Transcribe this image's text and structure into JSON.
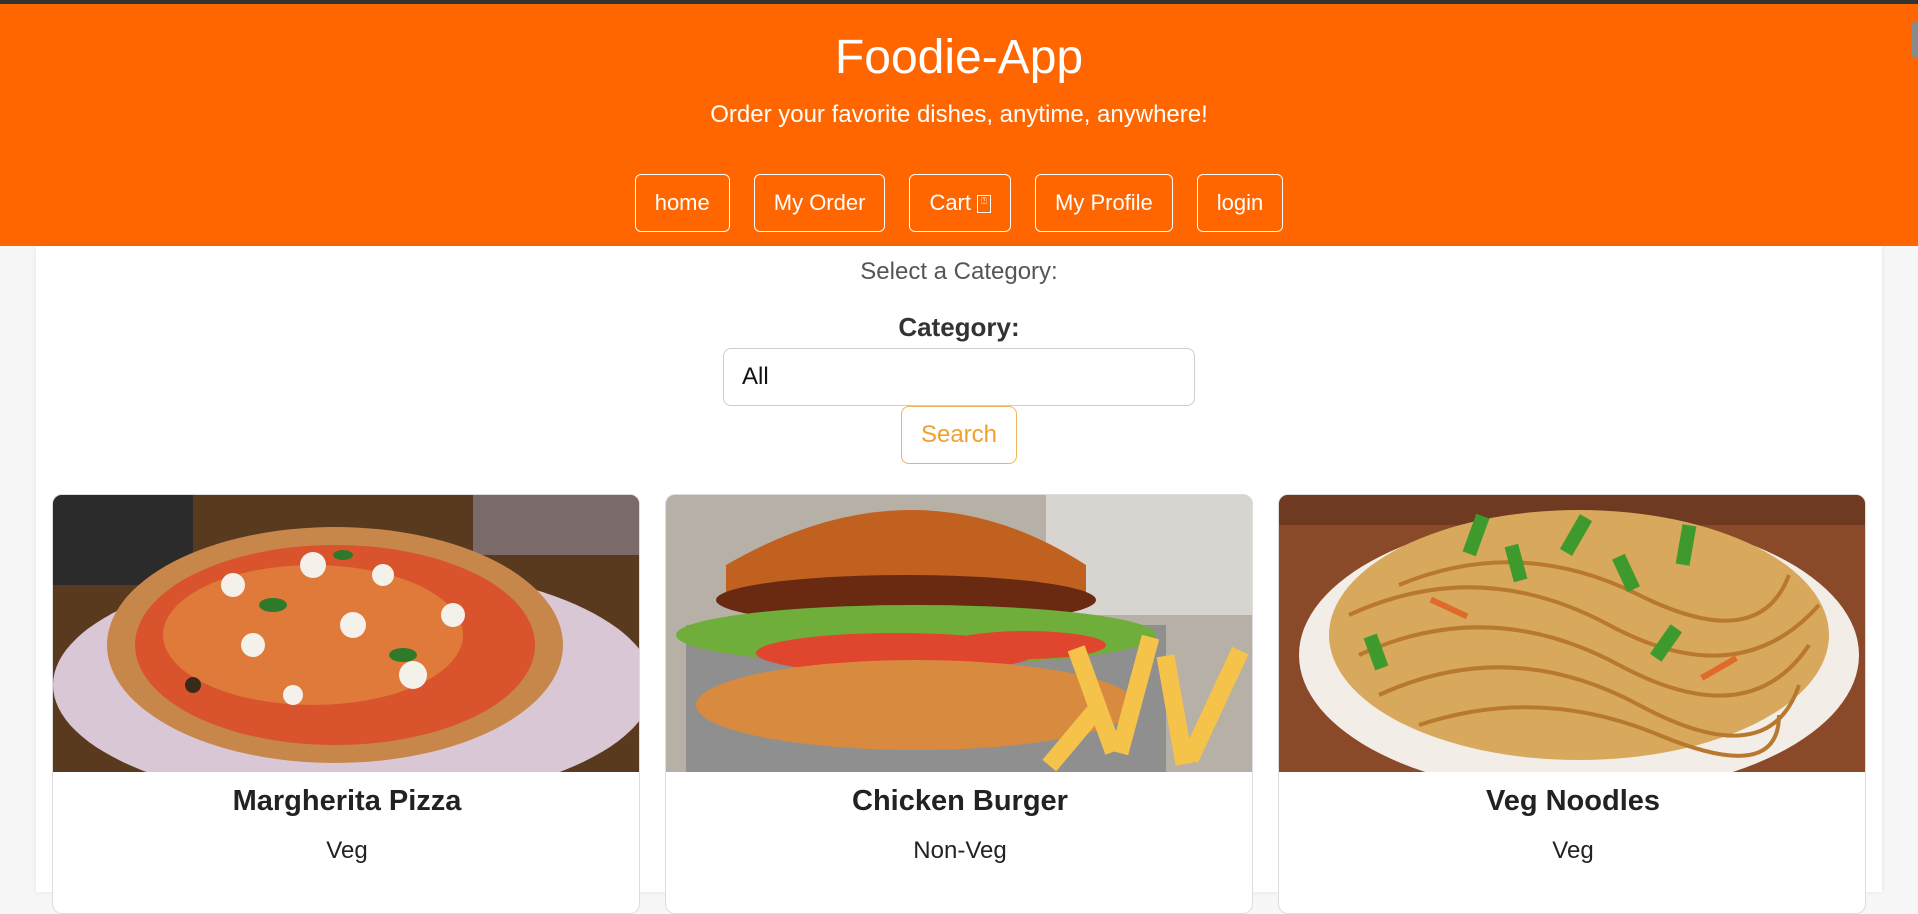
{
  "header": {
    "title": "Foodie-App",
    "tagline": "Order your favorite dishes, anytime, anywhere!",
    "background_color": "#ff6600"
  },
  "nav": {
    "items": [
      {
        "label": "home"
      },
      {
        "label": "My Order"
      },
      {
        "label": "Cart",
        "icon": "missing-glyph-icon",
        "glyph": "⍰"
      },
      {
        "label": "My Profile"
      },
      {
        "label": "login"
      }
    ]
  },
  "filter": {
    "prompt": "Select a Category:",
    "label": "Category:",
    "selected": "All",
    "search_label": "Search",
    "search_color": "#f0a030"
  },
  "products": [
    {
      "name": "Margherita Pizza",
      "category": "Veg",
      "image": "pizza-photo"
    },
    {
      "name": "Chicken Burger",
      "category": "Non-Veg",
      "image": "burger-photo"
    },
    {
      "name": "Veg Noodles",
      "category": "Veg",
      "image": "noodles-photo"
    }
  ]
}
